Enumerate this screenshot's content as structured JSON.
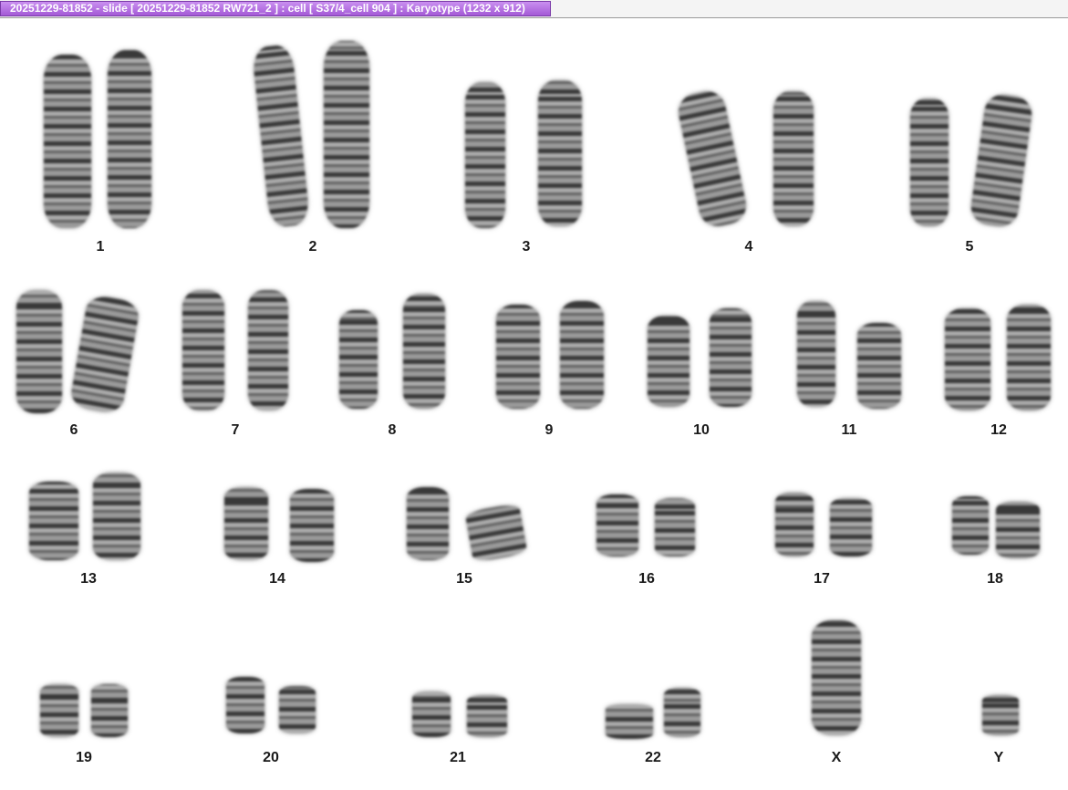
{
  "window": {
    "title": "20251229-81852 - slide [ 20251229-81852 RW721_2 ] : cell [ S37/4_cell 904 ] : Karyotype  (1232 x 912)"
  },
  "karyotype": {
    "labels": [
      "1",
      "2",
      "3",
      "4",
      "5",
      "6",
      "7",
      "8",
      "9",
      "10",
      "11",
      "12",
      "13",
      "14",
      "15",
      "16",
      "17",
      "18",
      "19",
      "20",
      "21",
      "22",
      "X",
      "Y"
    ]
  }
}
